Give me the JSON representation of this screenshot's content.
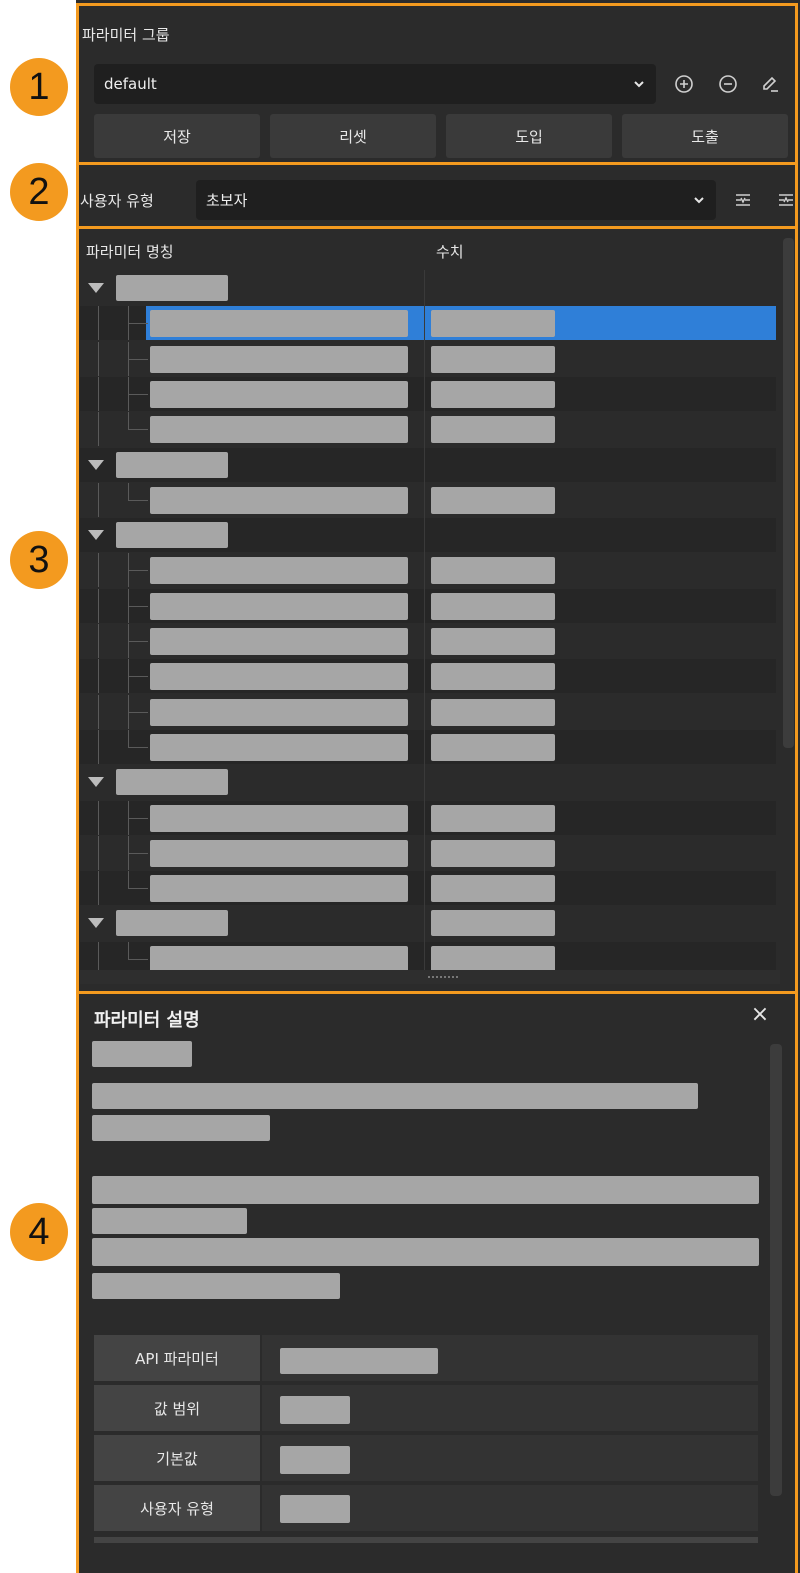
{
  "badges": [
    "1",
    "2",
    "3",
    "4"
  ],
  "param_group": {
    "title": "파라미터 그룹",
    "selected": "default",
    "icons": [
      "add-circle-icon",
      "remove-circle-icon",
      "edit-pencil-icon"
    ],
    "buttons": [
      "저장",
      "리셋",
      "도입",
      "도출"
    ]
  },
  "user_type": {
    "label": "사용자 유형",
    "selected": "초보자",
    "icons": [
      "expand-all-icon",
      "collapse-all-icon"
    ]
  },
  "tree": {
    "columns": [
      "파라미터 명칭",
      "수치"
    ],
    "selected_row_color": "#2f7fd8"
  },
  "description": {
    "title": "파라미터 설명",
    "close": "×",
    "table_labels": [
      "API 파라미터",
      "값 범위",
      "기본값",
      "사용자 유형"
    ]
  },
  "colors": {
    "accent_frame": "#f39a1f",
    "panel_bg": "#2b2b2b",
    "placeholder": "#a6a6a6"
  }
}
